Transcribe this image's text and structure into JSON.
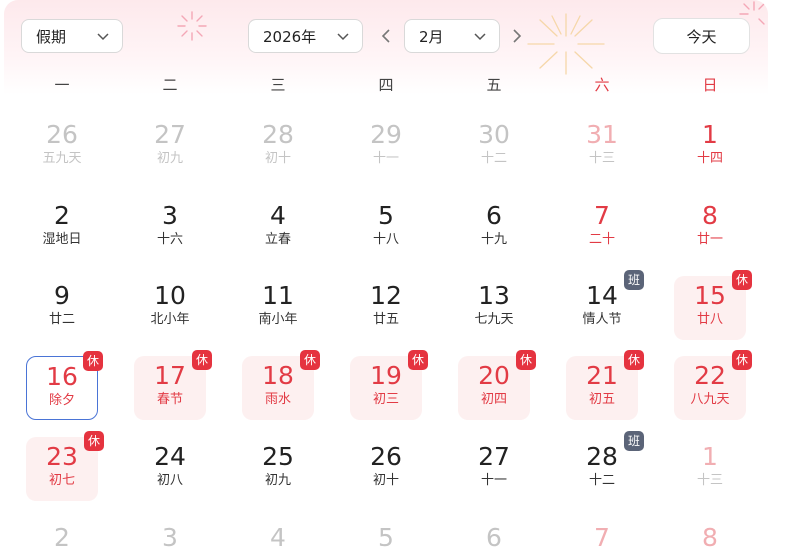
{
  "header": {
    "holiday_select": "假期",
    "year_select": "2026年",
    "month_select": "2月",
    "today_button": "今天"
  },
  "weekdays": [
    "一",
    "二",
    "三",
    "四",
    "五",
    "六",
    "日"
  ],
  "colors": {
    "accent_red": "#e23b45",
    "selected_border": "#4a74d6",
    "badge_rest": "#e5333f",
    "badge_work": "#5b6478"
  },
  "weeks": [
    [
      {
        "day": "26",
        "lunar": "五九天",
        "other": true
      },
      {
        "day": "27",
        "lunar": "初九",
        "other": true
      },
      {
        "day": "28",
        "lunar": "初十",
        "other": true
      },
      {
        "day": "29",
        "lunar": "十一",
        "other": true
      },
      {
        "day": "30",
        "lunar": "十二",
        "other": true
      },
      {
        "day": "31",
        "lunar": "十三",
        "other": true,
        "red": true
      },
      {
        "day": "1",
        "lunar": "十四",
        "red": true
      }
    ],
    [
      {
        "day": "2",
        "lunar": "湿地日"
      },
      {
        "day": "3",
        "lunar": "十六"
      },
      {
        "day": "4",
        "lunar": "立春"
      },
      {
        "day": "5",
        "lunar": "十八"
      },
      {
        "day": "6",
        "lunar": "十九"
      },
      {
        "day": "7",
        "lunar": "二十",
        "red": true
      },
      {
        "day": "8",
        "lunar": "廿一",
        "red": true
      }
    ],
    [
      {
        "day": "9",
        "lunar": "廿二"
      },
      {
        "day": "10",
        "lunar": "北小年"
      },
      {
        "day": "11",
        "lunar": "南小年"
      },
      {
        "day": "12",
        "lunar": "廿五"
      },
      {
        "day": "13",
        "lunar": "七九天"
      },
      {
        "day": "14",
        "lunar": "情人节",
        "badge": "班",
        "badge_type": "work"
      },
      {
        "day": "15",
        "lunar": "廿八",
        "red": true,
        "holiday": true,
        "badge": "休",
        "badge_type": "rest"
      }
    ],
    [
      {
        "day": "16",
        "lunar": "除夕",
        "holiday": true,
        "selected": true,
        "badge": "休",
        "badge_type": "rest"
      },
      {
        "day": "17",
        "lunar": "春节",
        "holiday": true,
        "badge": "休",
        "badge_type": "rest"
      },
      {
        "day": "18",
        "lunar": "雨水",
        "holiday": true,
        "badge": "休",
        "badge_type": "rest"
      },
      {
        "day": "19",
        "lunar": "初三",
        "holiday": true,
        "badge": "休",
        "badge_type": "rest"
      },
      {
        "day": "20",
        "lunar": "初四",
        "holiday": true,
        "badge": "休",
        "badge_type": "rest"
      },
      {
        "day": "21",
        "lunar": "初五",
        "holiday": true,
        "badge": "休",
        "badge_type": "rest"
      },
      {
        "day": "22",
        "lunar": "八九天",
        "holiday": true,
        "badge": "休",
        "badge_type": "rest"
      }
    ],
    [
      {
        "day": "23",
        "lunar": "初七",
        "holiday": true,
        "badge": "休",
        "badge_type": "rest"
      },
      {
        "day": "24",
        "lunar": "初八"
      },
      {
        "day": "25",
        "lunar": "初九"
      },
      {
        "day": "26",
        "lunar": "初十"
      },
      {
        "day": "27",
        "lunar": "十一"
      },
      {
        "day": "28",
        "lunar": "十二",
        "badge": "班",
        "badge_type": "work"
      },
      {
        "day": "1",
        "lunar": "十三",
        "other": true,
        "red": true
      }
    ],
    [
      {
        "day": "2",
        "lunar": "",
        "other": true
      },
      {
        "day": "3",
        "lunar": "",
        "other": true
      },
      {
        "day": "4",
        "lunar": "",
        "other": true
      },
      {
        "day": "5",
        "lunar": "",
        "other": true
      },
      {
        "day": "6",
        "lunar": "",
        "other": true
      },
      {
        "day": "7",
        "lunar": "",
        "other": true,
        "red": true
      },
      {
        "day": "8",
        "lunar": "",
        "other": true,
        "red": true
      }
    ]
  ]
}
